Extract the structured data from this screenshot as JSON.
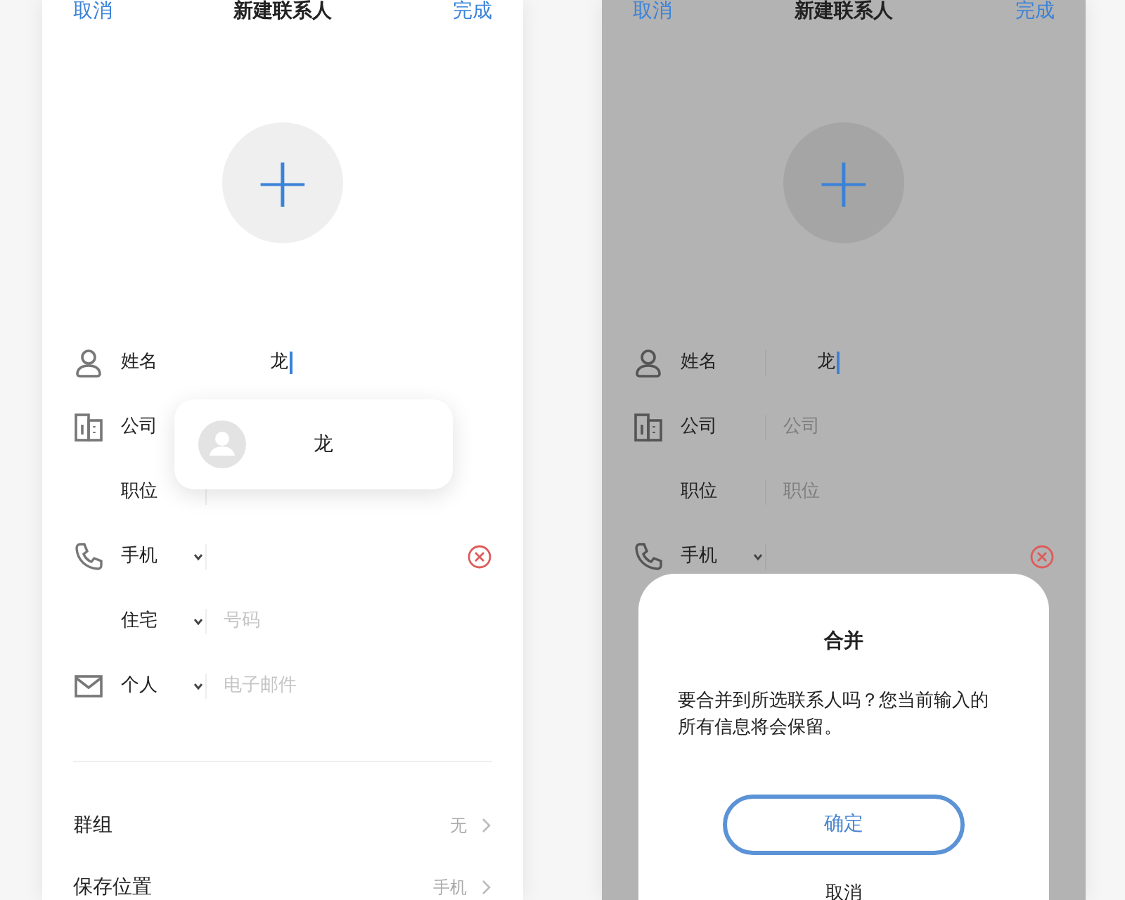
{
  "screens": [
    {
      "dimmed": false,
      "header": {
        "cancel": "取消",
        "title": "新建联系人",
        "done": "完成"
      },
      "avatar_button": "+",
      "fields": [
        {
          "label": "姓名",
          "dropdown": false,
          "value": "龙",
          "focused": true,
          "clear": false
        },
        {
          "label": "公司",
          "dropdown": false,
          "clear": false
        },
        {
          "label": "职位",
          "dropdown": false,
          "clear": false
        },
        {
          "label": "手机",
          "dropdown": true,
          "clear": true
        },
        {
          "label": "住宅",
          "dropdown": true,
          "placeholder": "号码",
          "clear": false
        },
        {
          "label": "个人",
          "dropdown": true,
          "placeholder": "电子邮件",
          "clear": false
        }
      ],
      "suggestion": {
        "name": "龙"
      },
      "settings": [
        {
          "label": "群组",
          "value": "无"
        },
        {
          "label": "保存位置",
          "value": "手机"
        }
      ]
    },
    {
      "dimmed": true,
      "header": {
        "cancel": "取消",
        "title": "新建联系人",
        "done": "完成"
      },
      "avatar_button": "+",
      "fields": [
        {
          "label": "姓名",
          "dropdown": false,
          "value": "龙",
          "focused": true,
          "clear": false
        },
        {
          "label": "公司",
          "dropdown": false,
          "placeholder": "公司",
          "clear": false
        },
        {
          "label": "职位",
          "dropdown": false,
          "placeholder": "职位",
          "clear": false
        },
        {
          "label": "手机",
          "dropdown": true,
          "clear": true
        }
      ],
      "dialog": {
        "title": "合并",
        "message": "要合并到所选联系人吗？您当前输入的所有信息将会保留。",
        "confirm": "确定",
        "cancel": "取消"
      }
    }
  ]
}
